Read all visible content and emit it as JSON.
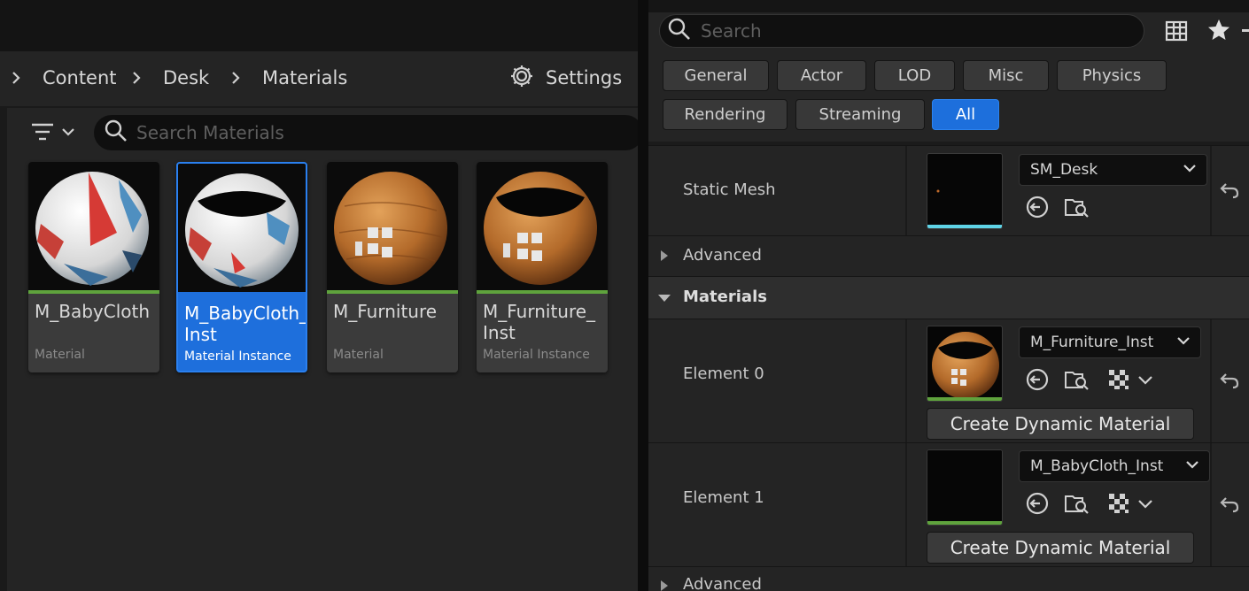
{
  "content_browser": {
    "breadcrumb": [
      "Content",
      "Desk",
      "Materials"
    ],
    "settings_label": "Settings",
    "search_placeholder": "Search Materials",
    "assets": [
      {
        "name": "M_BabyCloth",
        "type": "Material",
        "selected": false
      },
      {
        "name": "M_BabyCloth_ Inst",
        "type": "Material Instance",
        "selected": true
      },
      {
        "name": "M_Furniture",
        "type": "Material",
        "selected": false
      },
      {
        "name": "M_Furniture_ Inst",
        "type": "Material Instance",
        "selected": false
      }
    ]
  },
  "details": {
    "search_placeholder": "Search",
    "filters": [
      "General",
      "Actor",
      "LOD",
      "Misc",
      "Physics",
      "Rendering",
      "Streaming",
      "All"
    ],
    "active_filter": "All",
    "static_mesh": {
      "label": "Static Mesh",
      "value": "SM_Desk"
    },
    "advanced_label": "Advanced",
    "materials_section": "Materials",
    "elements": [
      {
        "label": "Element 0",
        "value": "M_Furniture_Inst",
        "button": "Create Dynamic Material"
      },
      {
        "label": "Element 1",
        "value": "M_BabyCloth_Inst",
        "button": "Create Dynamic Material"
      }
    ],
    "advanced_bottom_label": "Advanced"
  },
  "colors": {
    "accent_blue": "#1d6fdc",
    "asset_green": "#5fa33d",
    "mesh_cyan": "#5fd3e6"
  }
}
